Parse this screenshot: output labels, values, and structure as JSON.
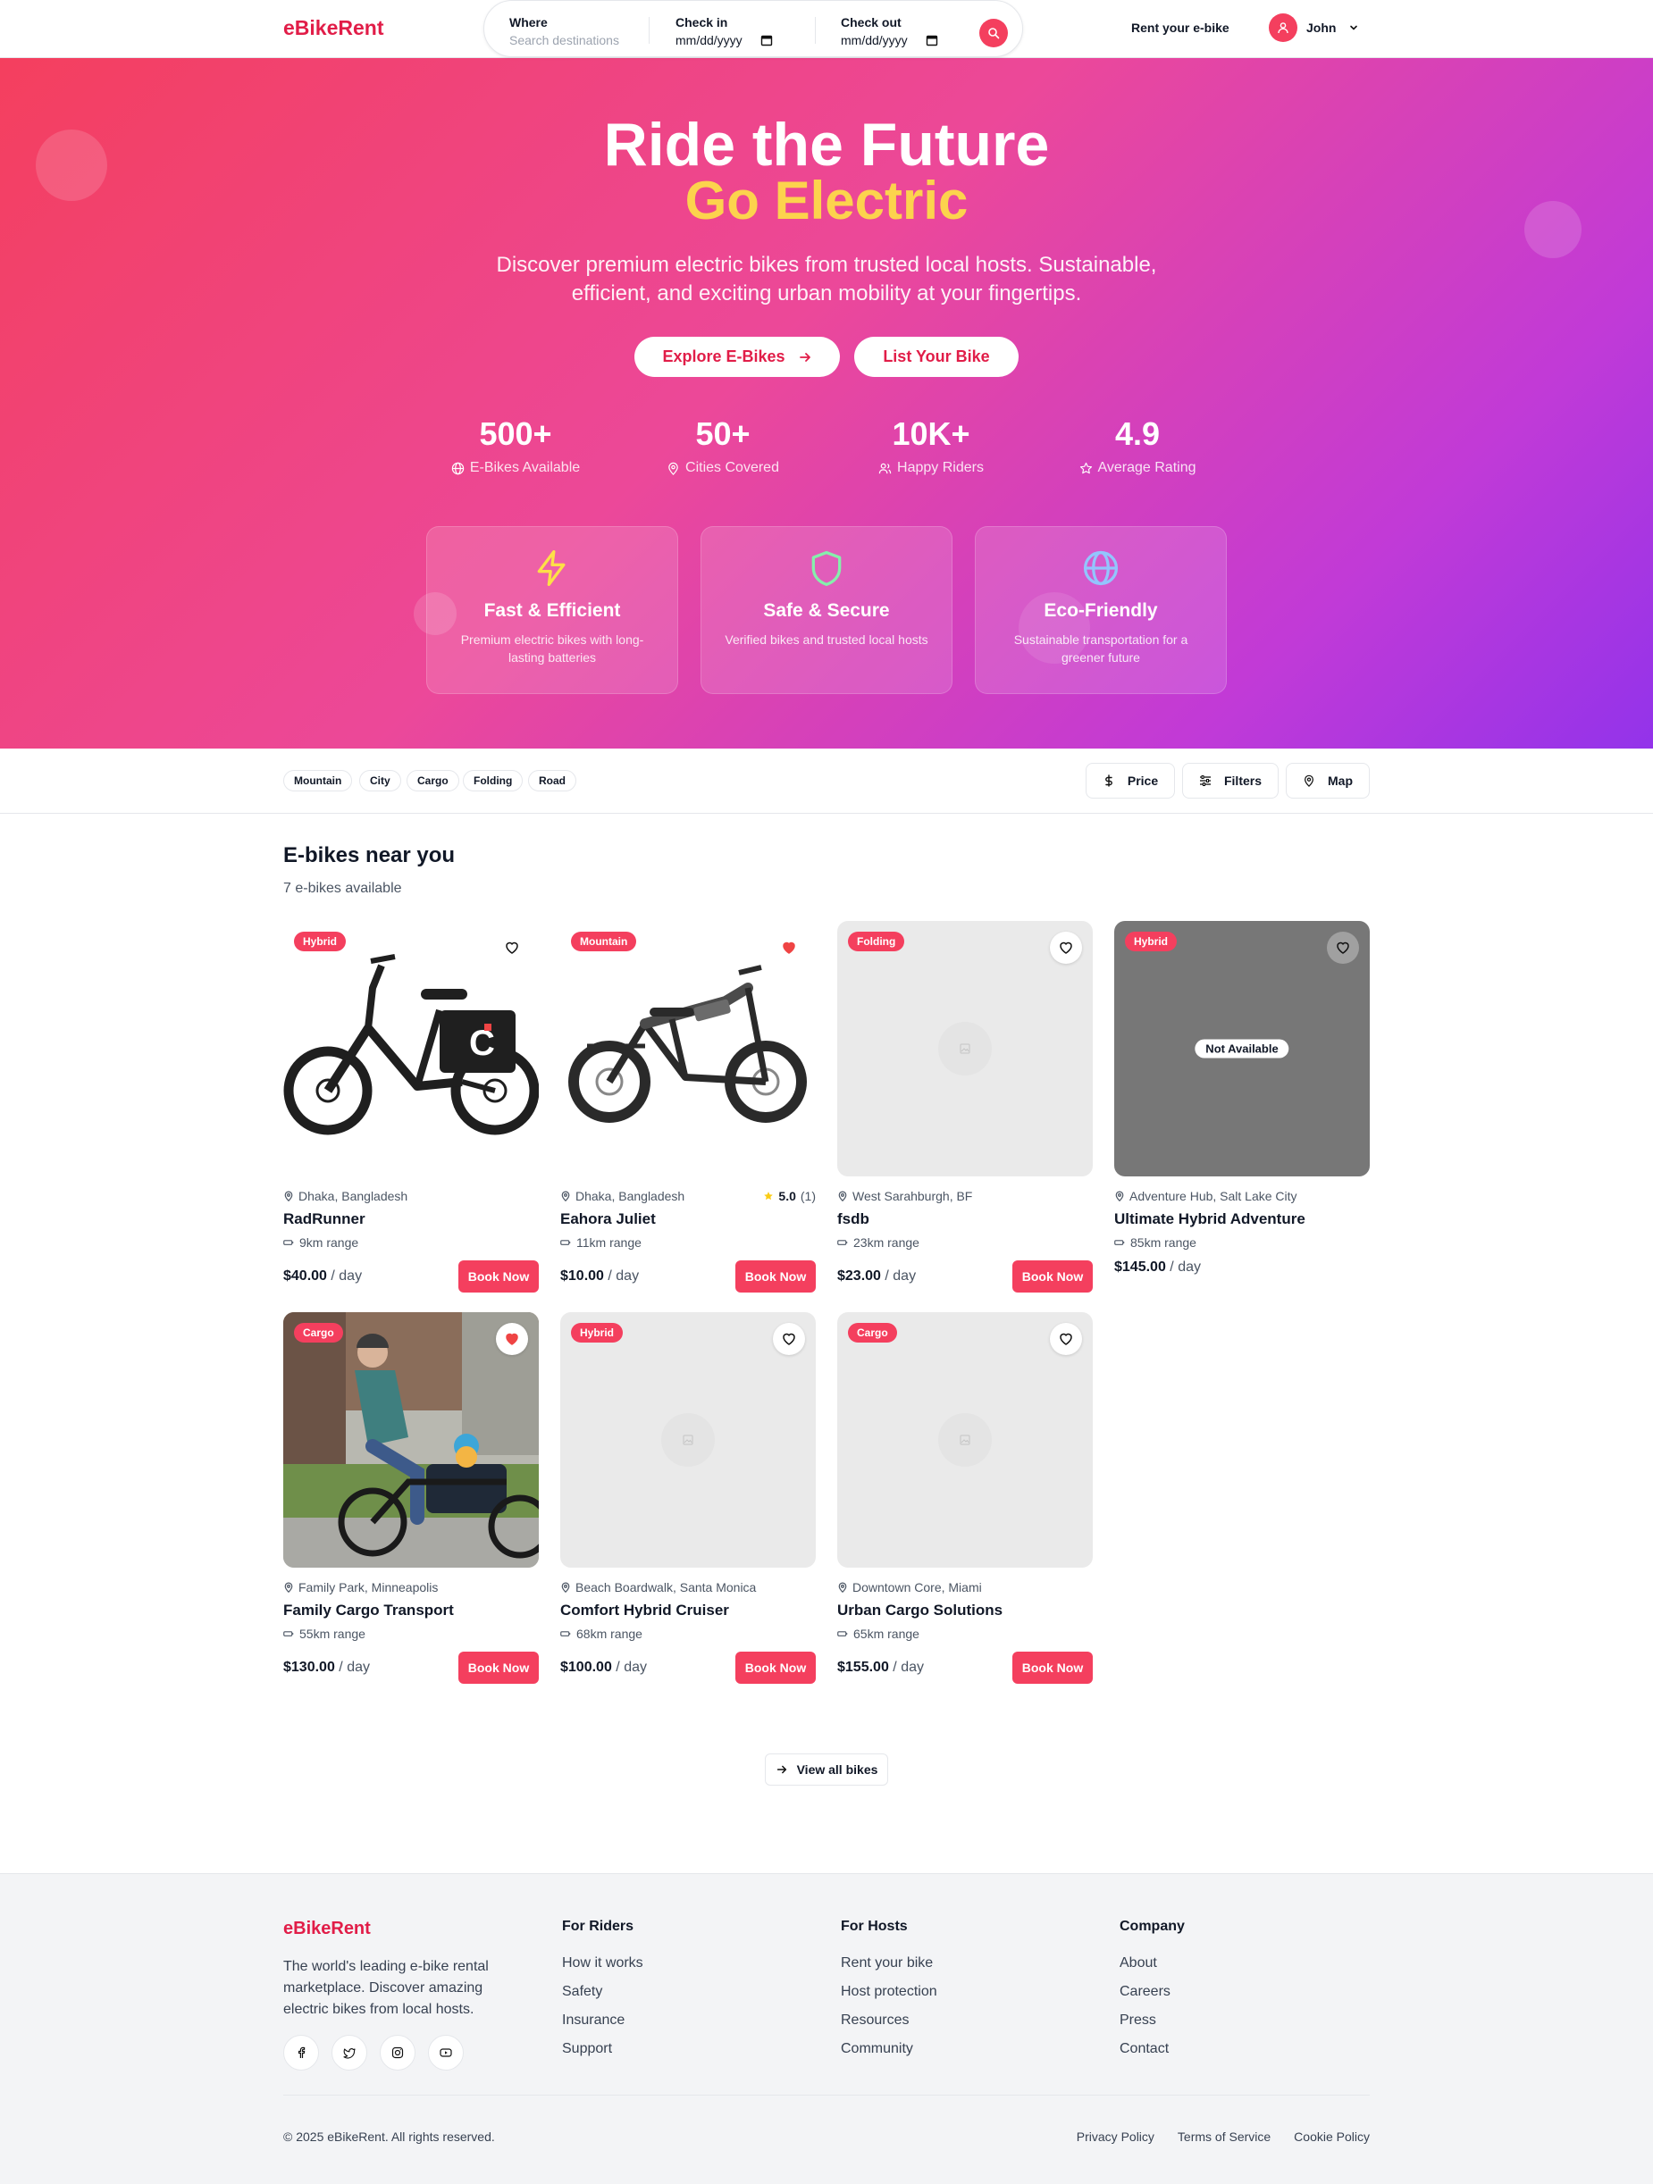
{
  "brand": {
    "name": "eBikeRent",
    "accent": "#f43f5e",
    "accent_dark": "#e11d48"
  },
  "search": {
    "where_label": "Where",
    "where_placeholder": "Search destinations",
    "checkin_label": "Check in",
    "checkin_value": "mm/dd/yyyy",
    "checkout_label": "Check out",
    "checkout_value": "mm/dd/yyyy"
  },
  "header": {
    "host_link": "Rent your e-bike",
    "user_name": "John"
  },
  "hero": {
    "title": "Ride the Future",
    "subtitle": "Go Electric",
    "description": "Discover premium electric bikes from trusted local hosts. Sustainable, efficient, and exciting urban mobility at your fingertips.",
    "primary_button": "Explore E-Bikes",
    "secondary_button": "List Your Bike",
    "gradient": [
      "#f43f5e",
      "#ec4899",
      "#9333ea"
    ],
    "stats": [
      {
        "value": "500+",
        "label": "E-Bikes Available",
        "icon": "globe-icon"
      },
      {
        "value": "50+",
        "label": "Cities Covered",
        "icon": "map-pin-icon"
      },
      {
        "value": "10K+",
        "label": "Happy Riders",
        "icon": "users-icon"
      },
      {
        "value": "4.9",
        "label": "Average Rating",
        "icon": "star-icon"
      }
    ],
    "features": [
      {
        "title": "Fast & Efficient",
        "desc": "Premium electric bikes with long-lasting batteries",
        "icon": "lightning-icon",
        "color": "#fde047"
      },
      {
        "title": "Safe & Secure",
        "desc": "Verified bikes and trusted local hosts",
        "icon": "shield-icon",
        "color": "#86efac"
      },
      {
        "title": "Eco-Friendly",
        "desc": "Sustainable transportation for a greener future",
        "icon": "globe-icon",
        "color": "#93c5fd"
      }
    ]
  },
  "filters": {
    "categories": [
      "Mountain",
      "City",
      "Cargo",
      "Folding",
      "Road"
    ],
    "price_button": "Price",
    "filters_button": "Filters",
    "map_button": "Map"
  },
  "listings": {
    "title": "E-bikes near you",
    "count": "7 e-bikes available",
    "book_label": "Book Now",
    "per_day": "/ day",
    "items": [
      {
        "badge": "Hybrid",
        "location": "Dhaka, Bangladesh",
        "name": "RadRunner",
        "range": "9km range",
        "price": "$40.00",
        "favorited": false,
        "available": true,
        "image": "black-cargo-ebike"
      },
      {
        "badge": "Mountain",
        "location": "Dhaka, Bangladesh",
        "name": "Eahora Juliet",
        "range": "11km range",
        "price": "$10.00",
        "favorited": true,
        "available": true,
        "rating": "5.0",
        "reviews": "(1)",
        "image": "fat-tire-ebike"
      },
      {
        "badge": "Folding",
        "location": "West Sarahburgh, BF",
        "name": "fsdb",
        "range": "23km range",
        "price": "$23.00",
        "favorited": false,
        "available": true,
        "image": "placeholder"
      },
      {
        "badge": "Hybrid",
        "location": "Adventure Hub, Salt Lake City",
        "name": "Ultimate Hybrid Adventure",
        "range": "85km range",
        "price": "$145.00",
        "favorited": false,
        "available": false,
        "status": "Not Available",
        "image": "placeholder"
      },
      {
        "badge": "Cargo",
        "location": "Family Park, Minneapolis",
        "name": "Family Cargo Transport",
        "range": "55km range",
        "price": "$130.00",
        "favorited": true,
        "available": true,
        "image": "family-cargo-photo"
      },
      {
        "badge": "Hybrid",
        "location": "Beach Boardwalk, Santa Monica",
        "name": "Comfort Hybrid Cruiser",
        "range": "68km range",
        "price": "$100.00",
        "favorited": false,
        "available": true,
        "image": "placeholder"
      },
      {
        "badge": "Cargo",
        "location": "Downtown Core, Miami",
        "name": "Urban Cargo Solutions",
        "range": "65km range",
        "price": "$155.00",
        "favorited": false,
        "available": true,
        "image": "placeholder"
      }
    ],
    "view_all": "View all bikes"
  },
  "footer": {
    "logo": "eBikeRent",
    "description": "The world's leading e-bike rental marketplace. Discover amazing electric bikes from local hosts.",
    "socials": [
      "facebook-icon",
      "twitter-icon",
      "instagram-icon",
      "youtube-icon"
    ],
    "columns": [
      {
        "title": "For Riders",
        "links": [
          "How it works",
          "Safety",
          "Insurance",
          "Support"
        ]
      },
      {
        "title": "For Hosts",
        "links": [
          "Rent your bike",
          "Host protection",
          "Resources",
          "Community"
        ]
      },
      {
        "title": "Company",
        "links": [
          "About",
          "Careers",
          "Press",
          "Contact"
        ]
      }
    ],
    "copyright": "© 2025 eBikeRent. All rights reserved.",
    "legal": [
      "Privacy Policy",
      "Terms of Service",
      "Cookie Policy"
    ]
  }
}
